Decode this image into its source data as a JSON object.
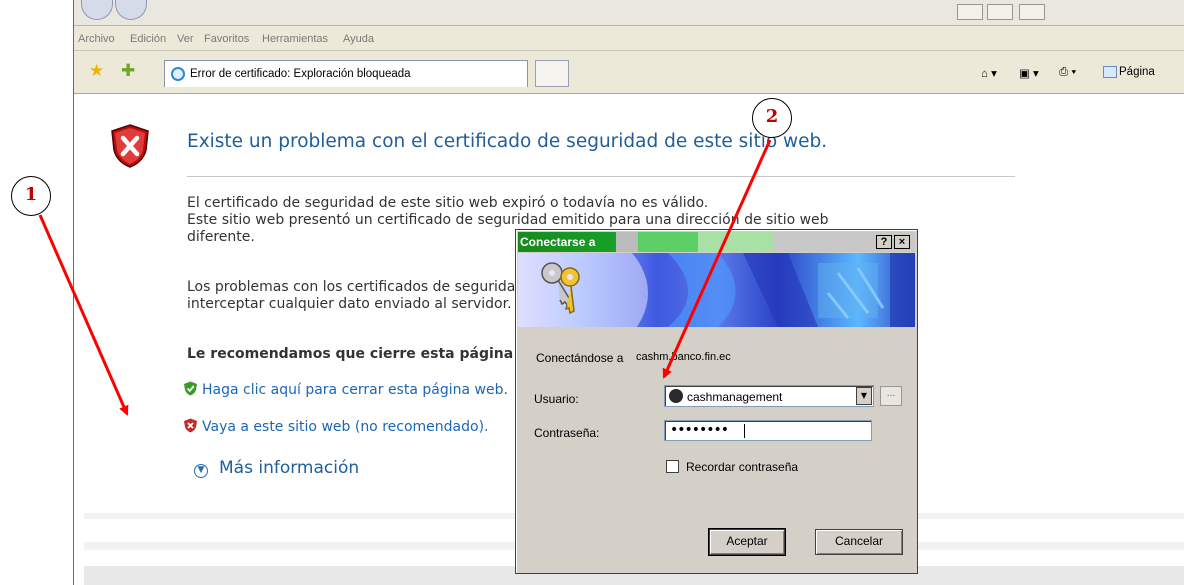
{
  "menubar": {
    "items": [
      "Archivo",
      "Edición",
      "Ver",
      "Favoritos",
      "Herramientas",
      "Ayuda"
    ]
  },
  "tab": {
    "title": "Error de certificado: Exploración bloqueada"
  },
  "command_bar": {
    "page_label": "Página"
  },
  "error_page": {
    "heading": "Existe un problema con el certificado de seguridad de este sitio web.",
    "paragraph1_line1": "El certificado de seguridad de este sitio web expiró o todavía no es válido.",
    "paragraph1_line2": "Este sitio web presentó un certificado de seguridad emitido para una dirección de sitio web",
    "paragraph1_line3": "diferente.",
    "paragraph2_line1": "Los problemas con los certificados de seguridad pueden indicar un intento de engañarle o de",
    "paragraph2_line2": "interceptar cualquier dato enviado al servidor.",
    "recommend": "Le recomendamos que cierre esta página web y no vaya a este sitio web.",
    "link_close": "Haga clic aquí para cerrar esta página web.",
    "link_continue": "Vaya a este sitio web (no recomendado).",
    "more_info": "Más información"
  },
  "dialog": {
    "title": "Conectarse a",
    "help_button": "?",
    "close_button": "×",
    "connecting_label": "Conectándose a",
    "connecting_host": "cashm.banco.fin.ec",
    "user_label": "Usuario:",
    "user_value": "cashmanagement",
    "password_label": "Contraseña:",
    "password_value": "••••••••",
    "remember_label": "Recordar contraseña",
    "ok_button": "Aceptar",
    "cancel_button": "Cancelar"
  },
  "annotations": {
    "marker1": "1",
    "marker2": "2",
    "arrow_color": "#ff0000"
  }
}
